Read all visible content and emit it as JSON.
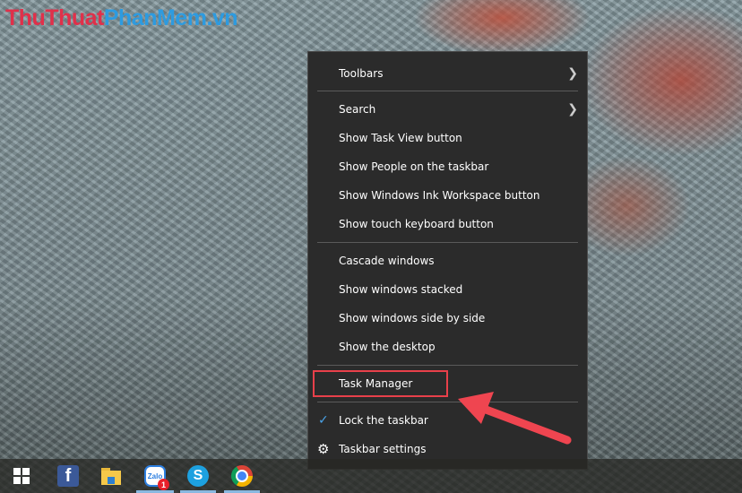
{
  "watermark": {
    "part1": "ThuThuat",
    "part2": "PhanMem.vn"
  },
  "menu": {
    "items": [
      {
        "label": "Toolbars",
        "submenu": true
      },
      {
        "label": "Search",
        "submenu": true
      },
      {
        "label": "Show Task View button"
      },
      {
        "label": "Show People on the taskbar"
      },
      {
        "label": "Show Windows Ink Workspace button"
      },
      {
        "label": "Show touch keyboard button"
      },
      {
        "label": "Cascade windows"
      },
      {
        "label": "Show windows stacked"
      },
      {
        "label": "Show windows side by side"
      },
      {
        "label": "Show the desktop"
      },
      {
        "label": "Task Manager",
        "highlighted": true
      },
      {
        "label": "Lock the taskbar",
        "checked": true
      },
      {
        "label": "Taskbar settings",
        "icon": "gear-icon"
      }
    ]
  },
  "taskbar": {
    "zalo_badge": "1",
    "zalo_text": "Zalo",
    "skype_text": "S",
    "facebook_text": "f"
  },
  "colors": {
    "highlight": "#e8404a",
    "arrow": "#ef4550",
    "check": "#4aa3e8"
  }
}
